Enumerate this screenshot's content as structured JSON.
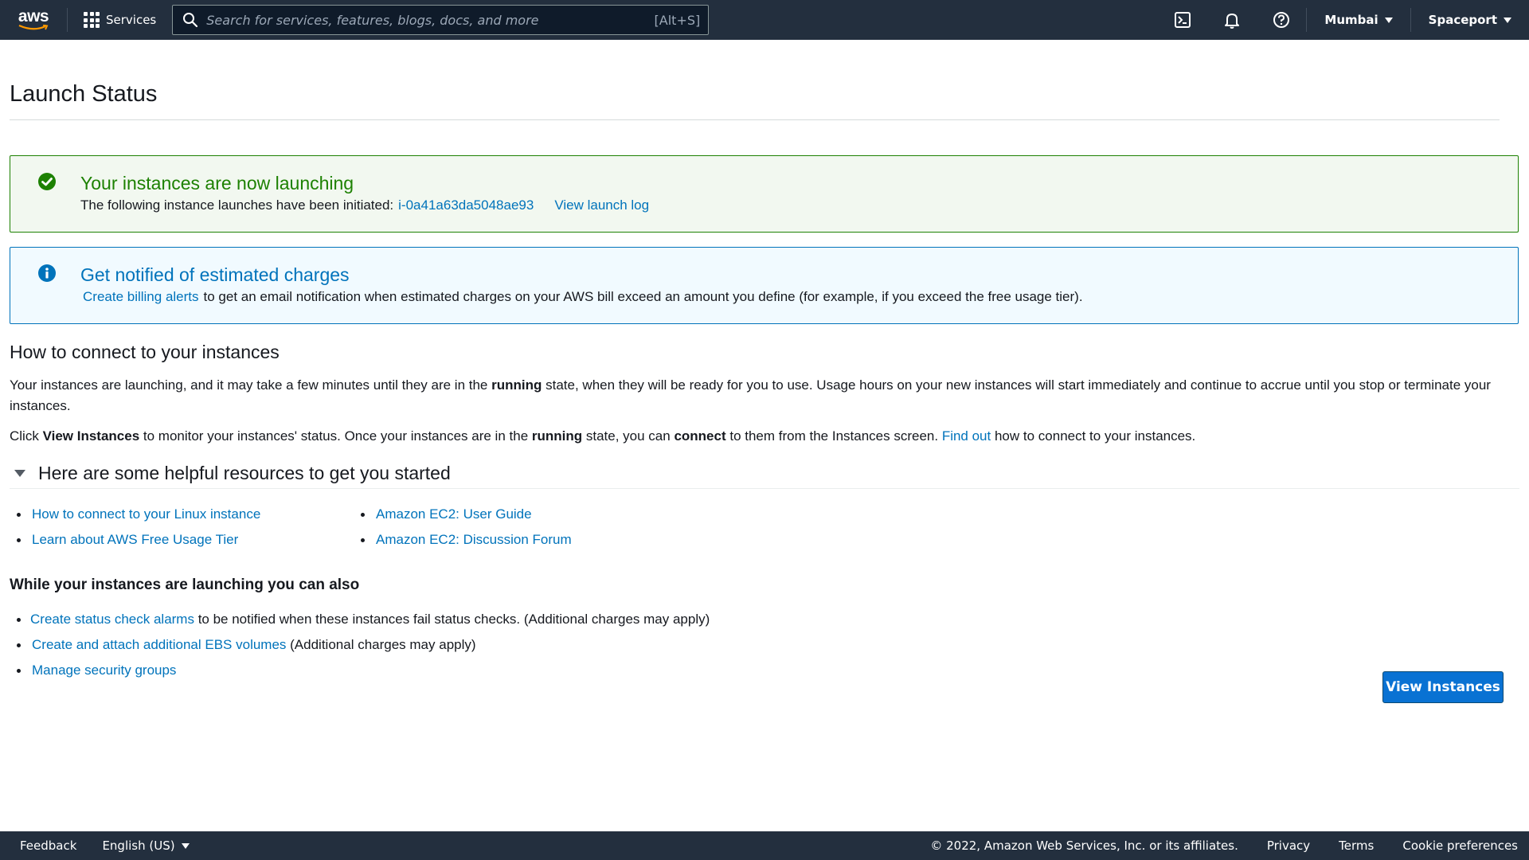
{
  "nav": {
    "logo": "aws",
    "services": "Services",
    "search_placeholder": "Search for services, features, blogs, docs, and more",
    "search_shortcut": "[Alt+S]",
    "region": "Mumbai",
    "account": "Spaceport",
    "icons": [
      "cloudshell-icon",
      "bell-icon",
      "help-icon"
    ]
  },
  "page": {
    "title": "Launch Status"
  },
  "success_alert": {
    "title": "Your instances are now launching",
    "body_text": "The following instance launches have been initiated:",
    "instance_id": "i-0a41a63da5048ae93",
    "view_log": "View launch log",
    "color": "#1d8102"
  },
  "info_alert": {
    "title": "Get notified of estimated charges",
    "link": "Create billing alerts",
    "body_text": "to get an email notification when estimated charges on your AWS bill exceed an amount you define (for example, if you exceed the free usage tier).",
    "color": "#0073bb"
  },
  "connect": {
    "heading": "How to connect to your instances",
    "para1_a": "Your instances are launching, and it may take a few minutes until they are in the ",
    "para1_b": "running",
    "para1_c": " state, when they will be ready for you to use. Usage hours on your new instances will start immediately and continue to accrue until you stop or terminate your instances.",
    "para2_a": "Click ",
    "para2_b": "View Instances",
    "para2_c": " to monitor your instances' status. Once your instances are in the ",
    "para2_d": "running",
    "para2_e": " state, you can ",
    "para2_f": "connect",
    "para2_g": " to them from the Instances screen. ",
    "para2_link": "Find out",
    "para2_h": " how to connect to your instances."
  },
  "resources": {
    "heading": "Here are some helpful resources to get you started",
    "col1": [
      "How to connect to your Linux instance",
      "Learn about AWS Free Usage Tier"
    ],
    "col2": [
      "Amazon EC2: User Guide",
      "Amazon EC2: Discussion Forum"
    ]
  },
  "also": {
    "heading": "While your instances are launching you can also",
    "items": [
      {
        "link": "Create status check alarms",
        "text": " to be notified when these instances fail status checks. (Additional charges may apply)"
      },
      {
        "link": "Create and attach additional EBS volumes",
        "text": " (Additional charges may apply)"
      },
      {
        "link": "Manage security groups",
        "text": ""
      }
    ]
  },
  "actions": {
    "view_instances": "View Instances"
  },
  "footer": {
    "feedback": "Feedback",
    "language": "English (US)",
    "copyright": "© 2022, Amazon Web Services, Inc. or its affiliates.",
    "privacy": "Privacy",
    "terms": "Terms",
    "cookies": "Cookie preferences"
  }
}
